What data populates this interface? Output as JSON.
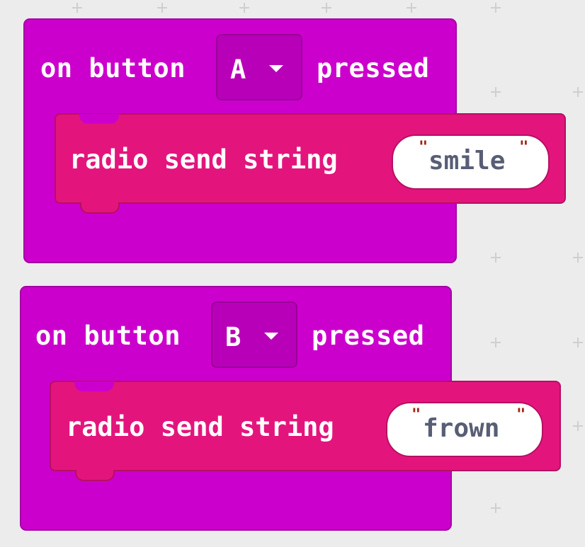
{
  "blocks": [
    {
      "event": {
        "prefix": "on button",
        "button": "A",
        "suffix": "pressed"
      },
      "statement": {
        "label": "radio send string",
        "open_quote": "\"",
        "value": "smile",
        "close_quote": "\""
      }
    },
    {
      "event": {
        "prefix": "on button",
        "button": "B",
        "suffix": "pressed"
      },
      "statement": {
        "label": "radio send string",
        "open_quote": "\"",
        "value": "frown",
        "close_quote": "\""
      }
    }
  ],
  "colors": {
    "workspace_bg": "#ececec",
    "event_block": "#cc00cc",
    "radio_block": "#e3157d",
    "string_text": "#575e75",
    "quote_mark": "#a3241a"
  },
  "icons": {
    "dropdown": "caret-down-icon",
    "grid": "plus-icon"
  }
}
